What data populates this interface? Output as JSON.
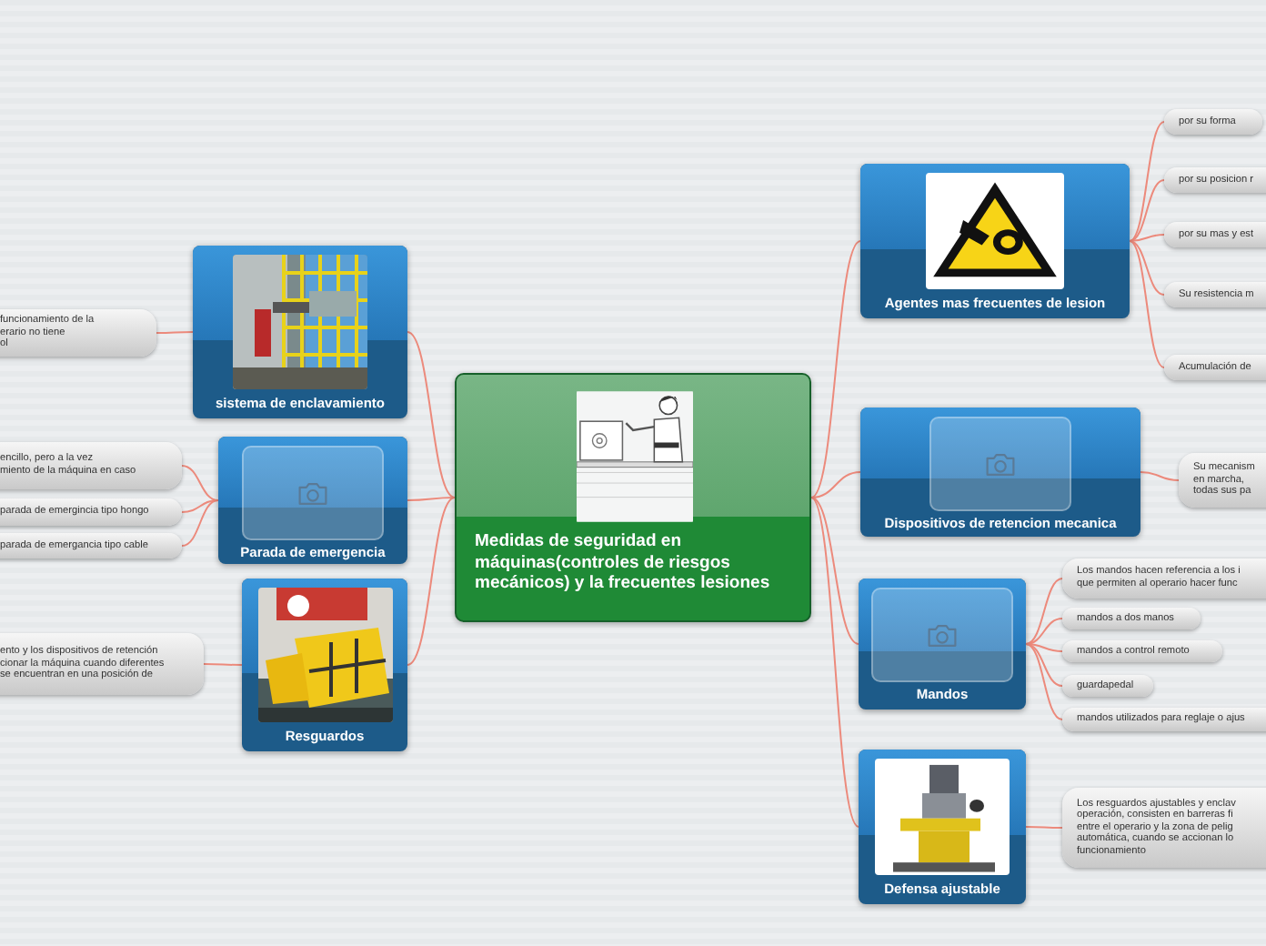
{
  "center": {
    "title": "Medidas de seguridad en máquinas(controles de riesgos mecánicos)  y la frecuentes lesiones"
  },
  "branches": [
    {
      "label": "sistema de enclavamiento",
      "kind": "picture",
      "leaves": [
        "funcionamiento de la\nerario no tiene\nol"
      ]
    },
    {
      "label": "Parada de emergencia",
      "kind": "placeholder",
      "leaves": [
        "encillo, pero a la vez\nmiento de la máquina en caso",
        "parada de emergincia tipo hongo",
        "parada de emergancia tipo cable"
      ]
    },
    {
      "label": "Resguardos",
      "kind": "picture",
      "leaves": [
        "ento y los dispositivos de retención\ncionar la máquina cuando diferentes\nse encuentran en una posición de"
      ]
    },
    {
      "label": "Agentes mas frecuentes de lesion",
      "kind": "picture",
      "leaves": [
        "por su forma",
        "por su posicion r",
        "por su mas y est",
        "Su resistencia m",
        "Acumulación de"
      ]
    },
    {
      "label": "Dispositivos de retencion mecanica",
      "kind": "placeholder",
      "leaves": [
        "Su mecanism\nen marcha, \ntodas sus pa"
      ]
    },
    {
      "label": "Mandos",
      "kind": "placeholder",
      "leaves": [
        "Los mandos hacen referencia a los i\nque permiten al operario hacer func",
        "mandos a dos manos",
        "mandos a control remoto",
        "guardapedal",
        "mandos utilizados para reglaje o ajus"
      ]
    },
    {
      "label": "Defensa ajustable",
      "kind": "picture",
      "leaves": [
        "Los resguardos ajustables y enclav\noperación, consisten en barreras fi\nentre el operario y la zona de pelig\nautomática, cuando se accionan lo\nfuncionamiento"
      ]
    }
  ]
}
